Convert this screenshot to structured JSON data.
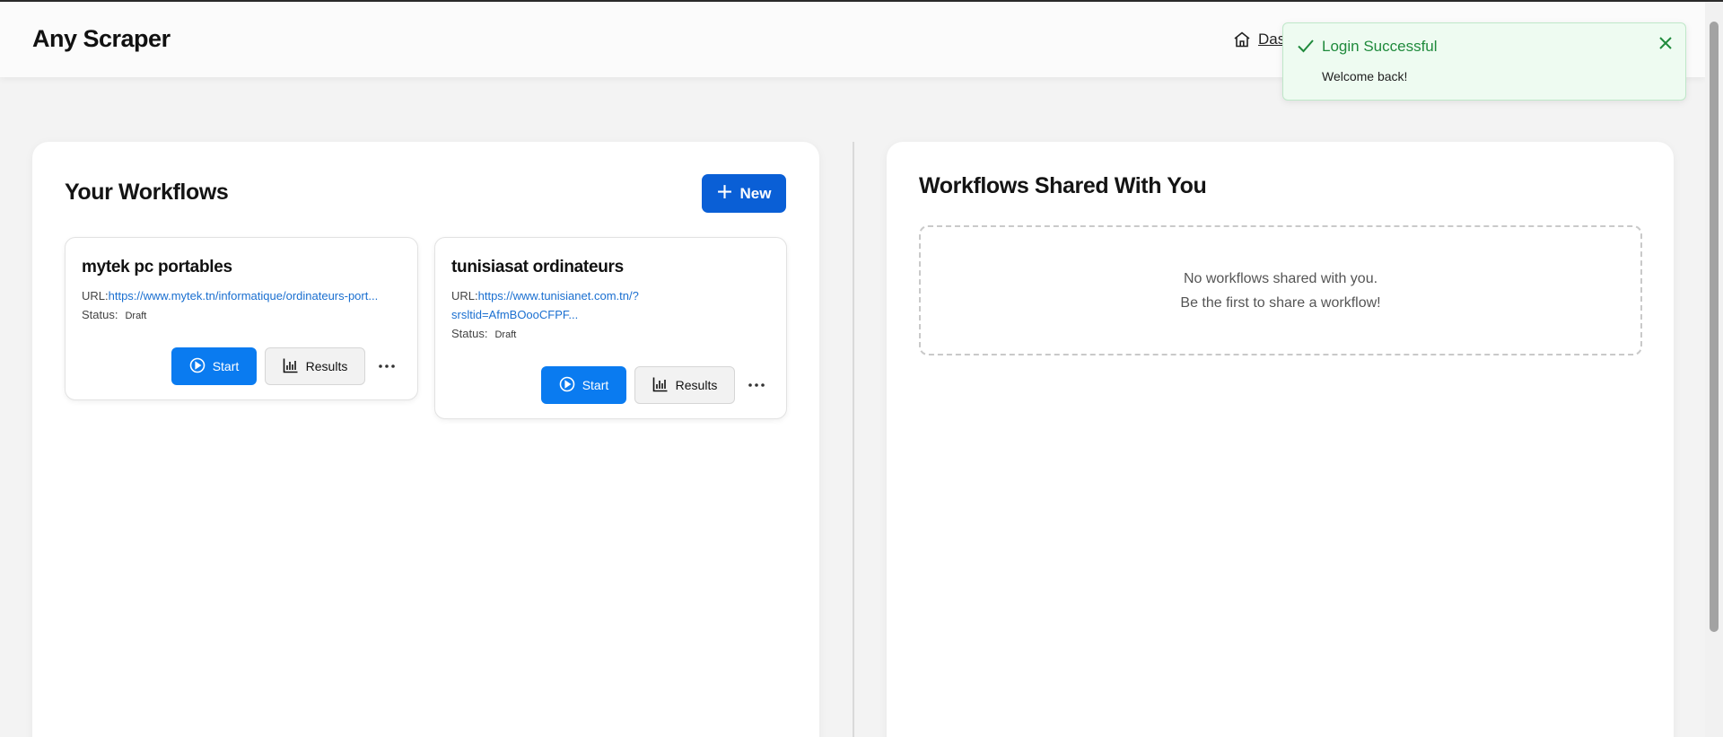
{
  "app": {
    "brand": "Any Scraper"
  },
  "nav": {
    "dashboard_label": "Das"
  },
  "toast": {
    "title": "Login Successful",
    "message": "Welcome back!"
  },
  "your_workflows": {
    "title": "Your Workflows",
    "new_label": "New",
    "cards": [
      {
        "name": "mytek pc portables",
        "url_label": "URL:",
        "url": "https://www.mytek.tn/informatique/ordinateurs-port...",
        "status_label": "Status:",
        "status": "Draft",
        "start_label": "Start",
        "results_label": "Results"
      },
      {
        "name": "tunisiasat ordinateurs",
        "url_label": "URL:",
        "url": "https://www.tunisianet.com.tn/?srsltid=AfmBOooCFPF...",
        "status_label": "Status:",
        "status": "Draft",
        "start_label": "Start",
        "results_label": "Results"
      }
    ]
  },
  "shared_workflows": {
    "title": "Workflows Shared With You",
    "empty_line1": "No workflows shared with you.",
    "empty_line2": "Be the first to share a workflow!"
  },
  "colors": {
    "primary": "#0a7bf0",
    "new_button": "#0a5fd6",
    "link": "#1a6fd0",
    "toast_success": "#1f8a3c",
    "toast_bg": "#eefbf1"
  },
  "icons": {
    "nav": "home-icon",
    "new": "plus-icon",
    "start": "play-circle-icon",
    "results": "bar-chart-icon",
    "more": "more-horizontal-icon",
    "toast_status": "check-icon",
    "toast_close": "close-icon"
  }
}
